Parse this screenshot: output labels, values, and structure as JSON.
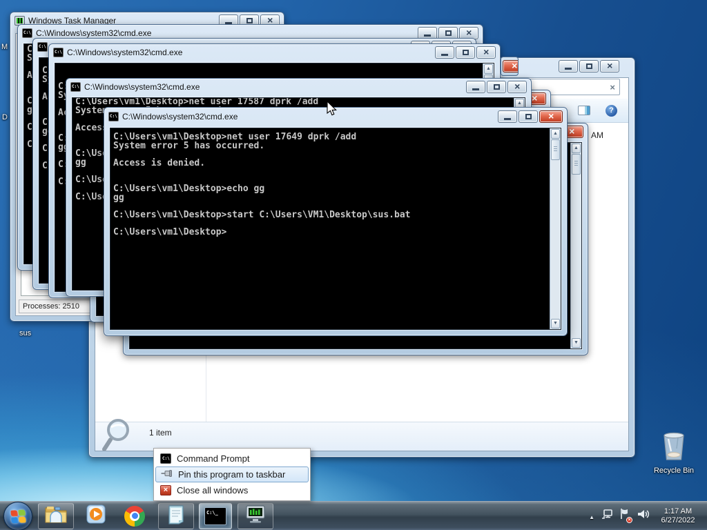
{
  "cmd": {
    "window_title": "C:\\Windows\\system32\\cmd.exe",
    "background_console_lines": [
      "C:\\Users\\vm1\\Desktop>net user 17587 dprk /add",
      "System error 5 has occurred.",
      "",
      "Access is denied.",
      "",
      "",
      "C:\\Users\\vm1\\Desktop>echo gg",
      "gg",
      "",
      "C:\\Users\\vm1\\Desktop>start C:\\Users\\VM1\\Desktop\\sus.bat",
      "",
      "C:\\Users\\vm1\\Desktop>"
    ],
    "front_console_lines": [
      "C:\\Users\\vm1\\Desktop>net user 17649 dprk /add",
      "System error 5 has occurred.",
      "",
      "Access is denied.",
      "",
      "",
      "C:\\Users\\vm1\\Desktop>echo gg",
      "gg",
      "",
      "C:\\Users\\vm1\\Desktop>start C:\\Users\\VM1\\Desktop\\sus.bat",
      "",
      "C:\\Users\\vm1\\Desktop>"
    ]
  },
  "task_manager": {
    "title": "Windows Task Manager",
    "status_processes": "Processes: 2510"
  },
  "search_window": {
    "list_fragment": "AM",
    "status_items": "1 item"
  },
  "jump_list": {
    "items": [
      {
        "label": "Command Prompt",
        "icon": "command-prompt"
      },
      {
        "label": "Pin this program to taskbar",
        "icon": "pin"
      },
      {
        "label": "Close all windows",
        "icon": "close-red"
      }
    ]
  },
  "desktop": {
    "partial_icon_label_1": "M",
    "partial_icon_label_2": "D",
    "sus_icon_label": "sus",
    "recycle_bin_label": "Recycle Bin"
  },
  "taskbar": {
    "clock_time": "1:17 AM",
    "clock_date": "6/27/2022",
    "icons": [
      "start",
      "windows-explorer",
      "windows-media-player",
      "google-chrome",
      "notepad",
      "command-prompt",
      "task-manager"
    ],
    "tray_icons": [
      "show-hidden-icons",
      "network",
      "action-center",
      "volume"
    ]
  },
  "colors": {
    "close_button_red": "#cf4b35",
    "selection_highlight": "#d3e6f8",
    "console_text": "#c8c8c8",
    "desktop_blue": "#1f60a8"
  }
}
